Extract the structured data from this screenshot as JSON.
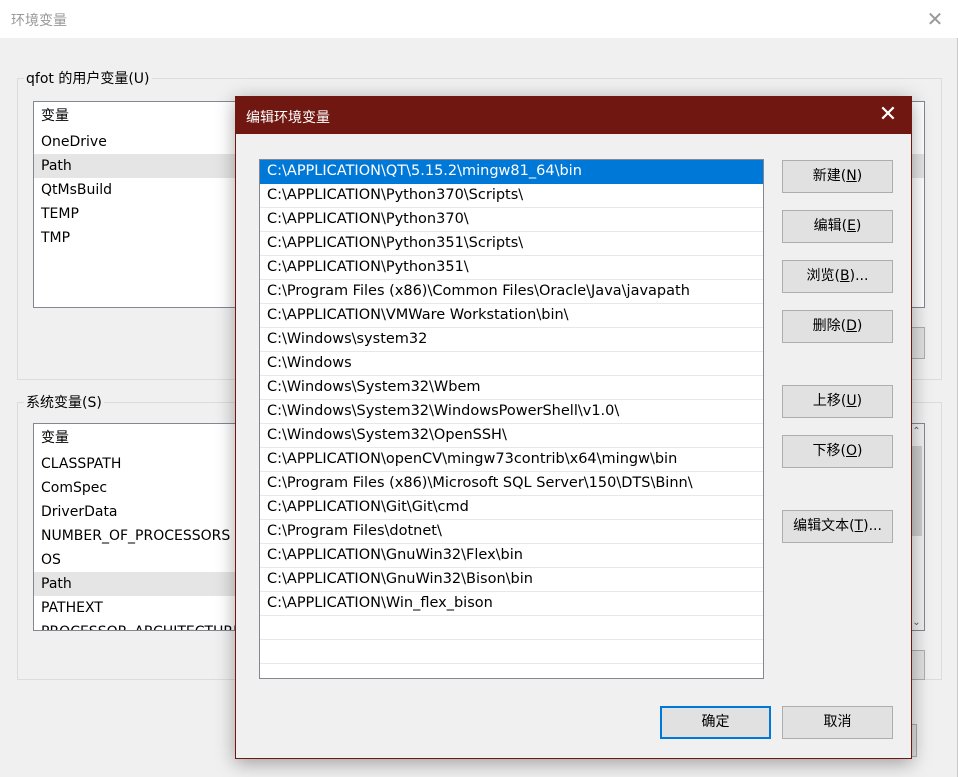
{
  "background_window": {
    "title": "环境变量",
    "close_glyph": "✕",
    "user_vars": {
      "label": "qfot 的用户变量(U)",
      "header": "变量",
      "items": [
        "OneDrive",
        "Path",
        "QtMsBuild",
        "TEMP",
        "TMP"
      ],
      "selected_index": 1
    },
    "system_vars": {
      "label": "系统变量(S)",
      "header": "变量",
      "items": [
        "CLASSPATH",
        "ComSpec",
        "DriverData",
        "NUMBER_OF_PROCESSORS",
        "OS",
        "Path",
        "PATHEXT",
        "PROCESSOR_ARCHITECTURE"
      ],
      "selected_index": 5
    }
  },
  "dialog": {
    "title": "编辑环境变量",
    "close_glyph": "✕",
    "accent_color": "#6f1710",
    "selection_color": "#0078d7",
    "paths": [
      "C:\\APPLICATION\\QT\\5.15.2\\mingw81_64\\bin",
      "C:\\APPLICATION\\Python370\\Scripts\\",
      "C:\\APPLICATION\\Python370\\",
      "C:\\APPLICATION\\Python351\\Scripts\\",
      "C:\\APPLICATION\\Python351\\",
      "C:\\Program Files (x86)\\Common Files\\Oracle\\Java\\javapath",
      "C:\\APPLICATION\\VMWare Workstation\\bin\\",
      "C:\\Windows\\system32",
      "C:\\Windows",
      "C:\\Windows\\System32\\Wbem",
      "C:\\Windows\\System32\\WindowsPowerShell\\v1.0\\",
      "C:\\Windows\\System32\\OpenSSH\\",
      "C:\\APPLICATION\\openCV\\mingw73contrib\\x64\\mingw\\bin",
      "C:\\Program Files (x86)\\Microsoft SQL Server\\150\\DTS\\Binn\\",
      "C:\\APPLICATION\\Git\\Git\\cmd",
      "C:\\Program Files\\dotnet\\",
      "C:\\APPLICATION\\GnuWin32\\Flex\\bin",
      "C:\\APPLICATION\\GnuWin32\\Bison\\bin",
      "C:\\APPLICATION\\Win_flex_bison",
      "",
      "",
      ""
    ],
    "selected_index": 0,
    "buttons": {
      "new": {
        "text": "新建(",
        "mnemonic": "N",
        "suffix": ")"
      },
      "edit": {
        "text": "编辑(",
        "mnemonic": "E",
        "suffix": ")"
      },
      "browse": {
        "text": "浏览(",
        "mnemonic": "B",
        "suffix": ")..."
      },
      "delete": {
        "text": "删除(",
        "mnemonic": "D",
        "suffix": ")"
      },
      "move_up": {
        "text": "上移(",
        "mnemonic": "U",
        "suffix": ")"
      },
      "move_down": {
        "text": "下移(",
        "mnemonic": "O",
        "suffix": ")"
      },
      "edit_text": {
        "text": "编辑文本(",
        "mnemonic": "T",
        "suffix": ")..."
      },
      "ok": {
        "text": "确定"
      },
      "cancel": {
        "text": "取消"
      }
    }
  }
}
